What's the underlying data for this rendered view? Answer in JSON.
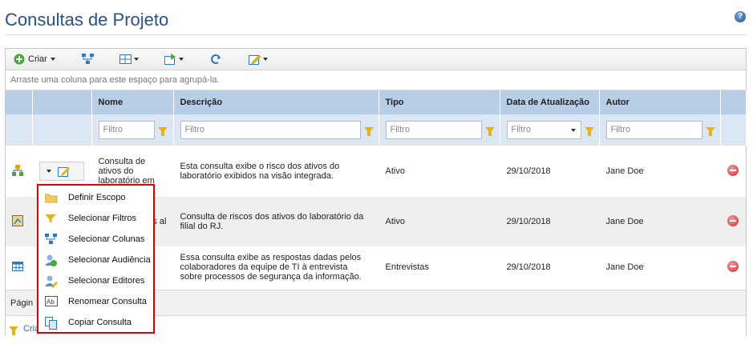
{
  "page": {
    "title": "Consultas de Projeto",
    "help_label": "?"
  },
  "toolbar": {
    "create_label": "Criar"
  },
  "groupbar": {
    "hint": "Arraste uma coluna para este espaço para agrupá-la."
  },
  "columns": [
    "Nome",
    "Descrição",
    "Tipo",
    "Data de Atualização",
    "Autor"
  ],
  "filter_placeholder": "Filtro",
  "rows": [
    {
      "name": "Consulta de ativos do laboratório em",
      "description": "Esta consulta exibe o risco dos ativos do laboratório exibidos na visão integrada.",
      "type": "Ativo",
      "date": "29/10/2018",
      "author": "Jane Doe"
    },
    {
      "name": "s al",
      "description": "Consulta de riscos dos ativos do laboratório da filial do RJ.",
      "type": "Ativo",
      "date": "29/10/2018",
      "author": "Jane Doe"
    },
    {
      "name": "",
      "description": "Essa consulta exibe as respostas dadas pelos colaboradores da equipe de TI à entrevista sobre processos de segurança da informação.",
      "type": "Entrevistas",
      "date": "29/10/2018",
      "author": "Jane Doe"
    }
  ],
  "pager": {
    "label": "Págin"
  },
  "footer": {
    "create_label": "Cria"
  },
  "context_menu": [
    {
      "label": "Definir Escopo",
      "icon": "folder-icon"
    },
    {
      "label": "Selecionar Filtros",
      "icon": "filter-icon"
    },
    {
      "label": "Selecionar Colunas",
      "icon": "columns-icon"
    },
    {
      "label": "Selecionar Audiência",
      "icon": "audience-icon"
    },
    {
      "label": "Selecionar Editores",
      "icon": "editors-icon"
    },
    {
      "label": "Renomear Consulta",
      "icon": "rename-icon"
    },
    {
      "label": "Copiar Consulta",
      "icon": "copy-icon"
    }
  ],
  "colors": {
    "accent": "#2a5181",
    "header_bg": "#b6cee6",
    "menu_border": "#e00000"
  }
}
